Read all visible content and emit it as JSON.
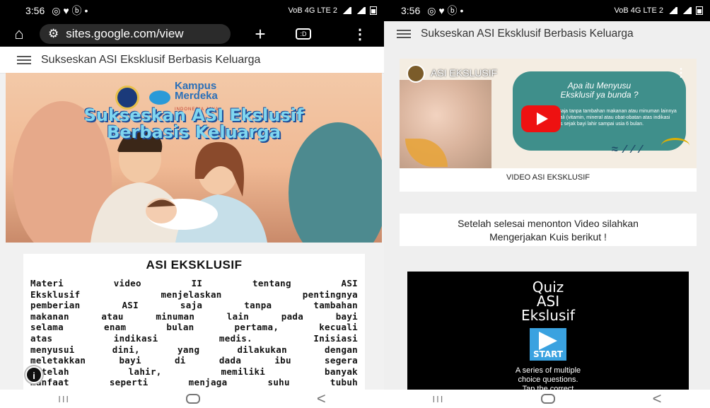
{
  "left": {
    "status": {
      "time": "3:56",
      "icons": "◎ ♥ ⓑ •",
      "network": "VoB 4G LTE 2"
    },
    "url_bar": {
      "url": "sites.google.com/view",
      "tabs_count": ":D"
    },
    "site_header": {
      "title": "Sukseskan ASI Eksklusif Berbasis Keluarga"
    },
    "banner": {
      "logo_text": "Kampus Merdeka",
      "logo_sub": "INDONESIA JAYA",
      "title_line1": "Sukseskan ASI Ekslusif",
      "title_line2": "Berbasis Keluarga"
    },
    "card": {
      "heading": "ASI EKSKLUSIF",
      "lines": [
        "Materi video II tentang ASI",
        "Eksklusif menjelaskan pentingnya",
        "pemberian ASI saja tanpa tambahan",
        "makanan atau minuman lain pada bayi",
        "selama enam bulan pertama, kecuali",
        "atas indikasi medis. Inisiasi",
        "menyusui dini, yang dilakukan dengan",
        "meletakkan bayi di dada ibu segera",
        "setelah lahir, memiliki banyak",
        "manfaat seperti menjaga suhu tubuh"
      ]
    },
    "info_icon": "i"
  },
  "right": {
    "status": {
      "time": "3:56",
      "icons": "◎ ♥ ⓑ •",
      "network": "VoB 4G LTE 2"
    },
    "site_header": {
      "title": "Sukseskan ASI Eksklusif Berbasis Keluarga"
    },
    "video": {
      "channel_name": "ASI EKSLUSIF",
      "slide_title_1": "Apa itu Menyusu",
      "slide_title_2": "Eksklusif ya bunda ?",
      "slide_text": "ASI saja tanpa tambahan makanan atau minuman lainnya kecuali (vitamin, mineral atau obat-obatan atas indikasi medis sejak bayi lahir sampai usia 6 bulan.",
      "caption": "VIDEO ASI EKSKLUSIF"
    },
    "notice": {
      "line1": "Setelah selesai menonton Video silahkan",
      "line2": "Mengerjakan Kuis berikut !"
    },
    "quiz": {
      "title_1": "Quiz",
      "title_2": "ASI",
      "title_3": "Ekslusif",
      "start_label": "START",
      "desc_1": "A series of multiple",
      "desc_2": "choice questions.",
      "desc_3": "Tap the correct"
    }
  },
  "nav": {
    "recent": "III",
    "home": "○",
    "back": "<"
  },
  "colors": {
    "status_bg": "#000000",
    "banner_title": "#7fd6f0",
    "quiz_bg": "#000000",
    "start_btn": "#3aa2e0",
    "teal": "#3f8f8b",
    "youtube_red": "#ee1111"
  }
}
